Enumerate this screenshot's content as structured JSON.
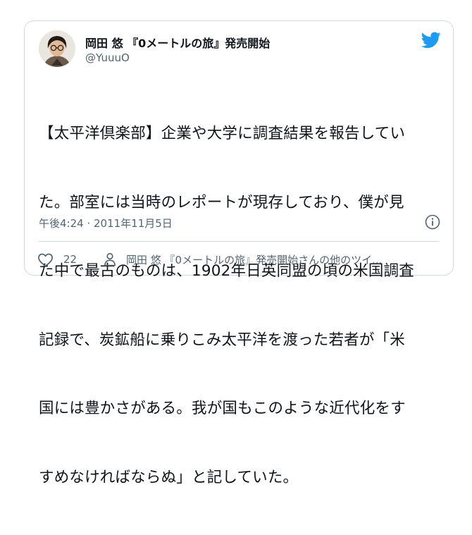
{
  "author": {
    "display_name": "岡田 悠 『0メートルの旅』発売開始",
    "handle": "@YuuuO"
  },
  "tweet": {
    "lines": [
      "【太平洋倶楽部】企業や大学に調査結果を報告してい",
      "た。部室には当時のレポートが現存しており、僕が見",
      "た中で最古のものは、1902年日英同盟の頃の米国調査",
      "記録で、炭鉱船に乗りこみ太平洋を渡った若者が「米",
      "国には豊かさがある。我が国もこのような近代化をす",
      "すめなければならぬ」と記していた。"
    ],
    "timestamp": "午後4:24 · 2011年11月5日"
  },
  "actions": {
    "like_count": "22",
    "more_label": "岡田 悠 『0メートルの旅』発売開始さんの他のツイ..."
  },
  "icons": {
    "brand": "twitter-bird-icon",
    "info": "info-icon",
    "like": "heart-icon",
    "profile": "person-icon"
  },
  "colors": {
    "twitter_blue": "#1d9bf0",
    "secondary_text": "#536471",
    "border": "#cfd9de"
  }
}
